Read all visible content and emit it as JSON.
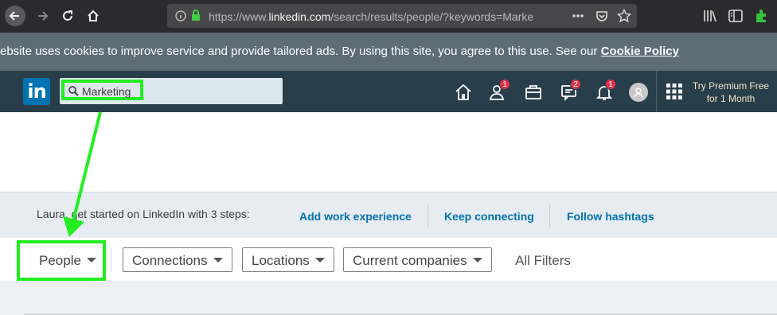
{
  "browser": {
    "url_prefix": "https://www.",
    "url_domain": "linkedin.com",
    "url_path": "/search/results/people/?keywords=Marke",
    "icons": [
      "back-icon",
      "forward-icon",
      "reload-icon",
      "home-icon",
      "info-icon",
      "lock-icon",
      "more-icon",
      "pocket-icon",
      "star-icon",
      "library-icon",
      "sidebar-icon",
      "menu-icon",
      "extension-icon"
    ]
  },
  "cookie_banner": {
    "text": "ebsite uses cookies to improve service and provide tailored ads. By using this site, you agree to this use. See our ",
    "link": "Cookie Policy"
  },
  "header": {
    "logo": "in",
    "search_value": "Marketing",
    "network_badge": "1",
    "messaging_badge": "2",
    "notifications_badge": "1",
    "premium_line1": "Try Premium Free",
    "premium_line2": "for 1 Month"
  },
  "steps": {
    "intro": "Laura, get started on LinkedIn with 3 steps:",
    "links": [
      "Add work experience",
      "Keep connecting",
      "Follow hashtags"
    ]
  },
  "filters": {
    "people": "People",
    "buttons": [
      "Connections",
      "Locations",
      "Current companies"
    ],
    "all_filters": "All Filters"
  },
  "colors": {
    "highlight": "#22ee22",
    "linkedin_blue": "#0073b1",
    "header_bg": "#283e4a",
    "badge_red": "#e0344a"
  }
}
